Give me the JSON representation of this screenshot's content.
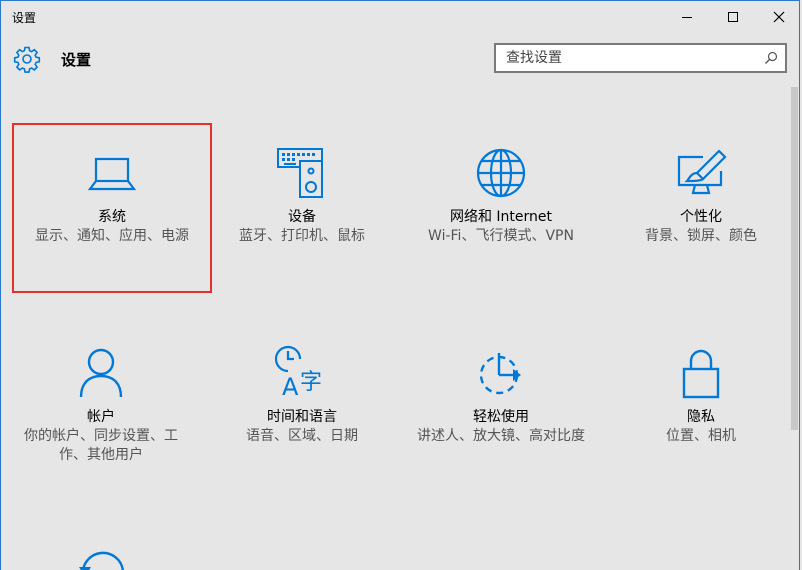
{
  "window": {
    "title": "设置"
  },
  "header": {
    "title": "设置",
    "search_placeholder": "查找设置"
  },
  "tiles": [
    {
      "name": "系统",
      "desc": "显示、通知、应用、电源",
      "icon": "laptop-icon",
      "selected": true
    },
    {
      "name": "设备",
      "desc": "蓝牙、打印机、鼠标",
      "icon": "devices-icon"
    },
    {
      "name": "网络和 Internet",
      "desc": "Wi-Fi、飞行模式、VPN",
      "icon": "globe-icon"
    },
    {
      "name": "个性化",
      "desc": "背景、锁屏、颜色",
      "icon": "personalization-icon"
    },
    {
      "name": "帐户",
      "desc": "你的帐户、同步设置、工作、其他用户",
      "icon": "person-icon"
    },
    {
      "name": "时间和语言",
      "desc": "语音、区域、日期",
      "icon": "time-language-icon"
    },
    {
      "name": "轻松使用",
      "desc": "讲述人、放大镜、高对比度",
      "icon": "ease-of-access-icon"
    },
    {
      "name": "隐私",
      "desc": "位置、相机",
      "icon": "lock-icon"
    }
  ],
  "colors": {
    "accent": "#0078d7",
    "selection_border": "#e5302c",
    "background": "#e6e6e6"
  }
}
